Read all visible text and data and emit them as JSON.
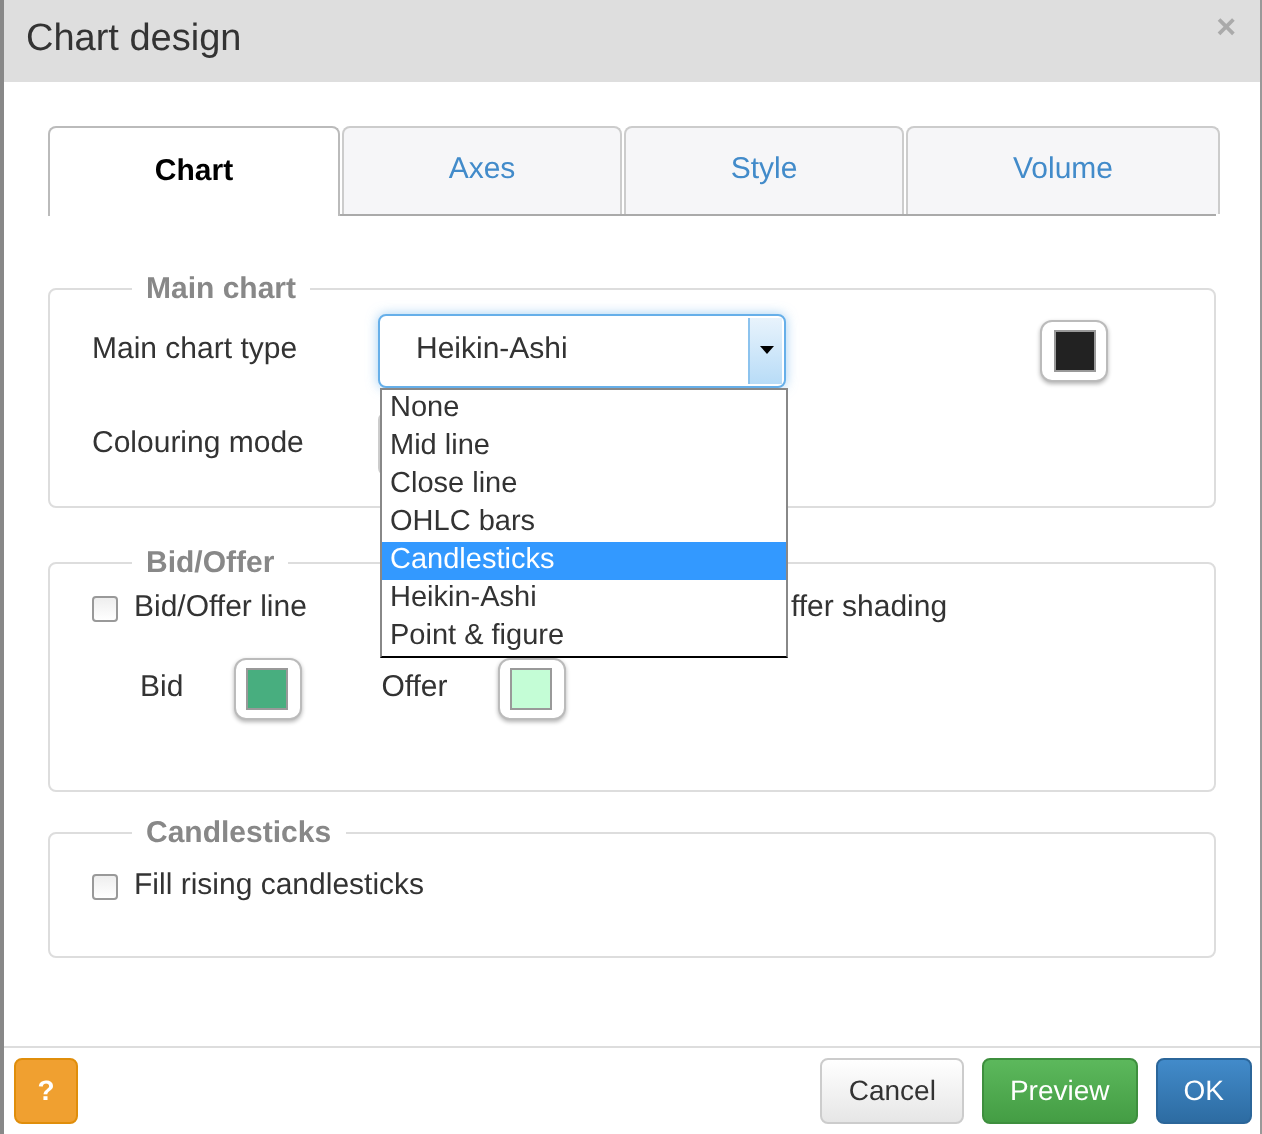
{
  "window": {
    "title": "Chart design",
    "close": "×"
  },
  "tabs": [
    {
      "label": "Chart",
      "selected": true
    },
    {
      "label": "Axes",
      "selected": false
    },
    {
      "label": "Style",
      "selected": false
    },
    {
      "label": "Volume",
      "selected": false
    }
  ],
  "main_chart": {
    "legend": "Main chart",
    "type_label": "Main chart type",
    "type_value": "Heikin-Ashi",
    "color": "#222222",
    "colouring_label": "Colouring mode",
    "options": [
      {
        "label": "None",
        "selected": false
      },
      {
        "label": "Mid line",
        "selected": false
      },
      {
        "label": "Close line",
        "selected": false
      },
      {
        "label": "OHLC bars",
        "selected": false
      },
      {
        "label": "Candlesticks",
        "selected": true
      },
      {
        "label": "Heikin-Ashi",
        "selected": false
      },
      {
        "label": "Point & figure",
        "selected": false
      }
    ]
  },
  "bid_offer": {
    "legend": "Bid/Offer",
    "line_label": "Bid/Offer line",
    "line_checked": false,
    "shading_label": "ffer shading",
    "swatches": [
      {
        "label": "Bid",
        "color": "#48ae7f"
      },
      {
        "label": "Offer",
        "color": "#c4fdd6"
      }
    ]
  },
  "candlesticks": {
    "legend": "Candlesticks",
    "fill_label": "Fill rising candlesticks",
    "fill_checked": false
  },
  "footer": {
    "help": "?",
    "buttons": [
      {
        "label": "Cancel",
        "kind": "cancel"
      },
      {
        "label": "Preview",
        "kind": "preview"
      },
      {
        "label": "OK",
        "kind": "ok"
      }
    ]
  }
}
